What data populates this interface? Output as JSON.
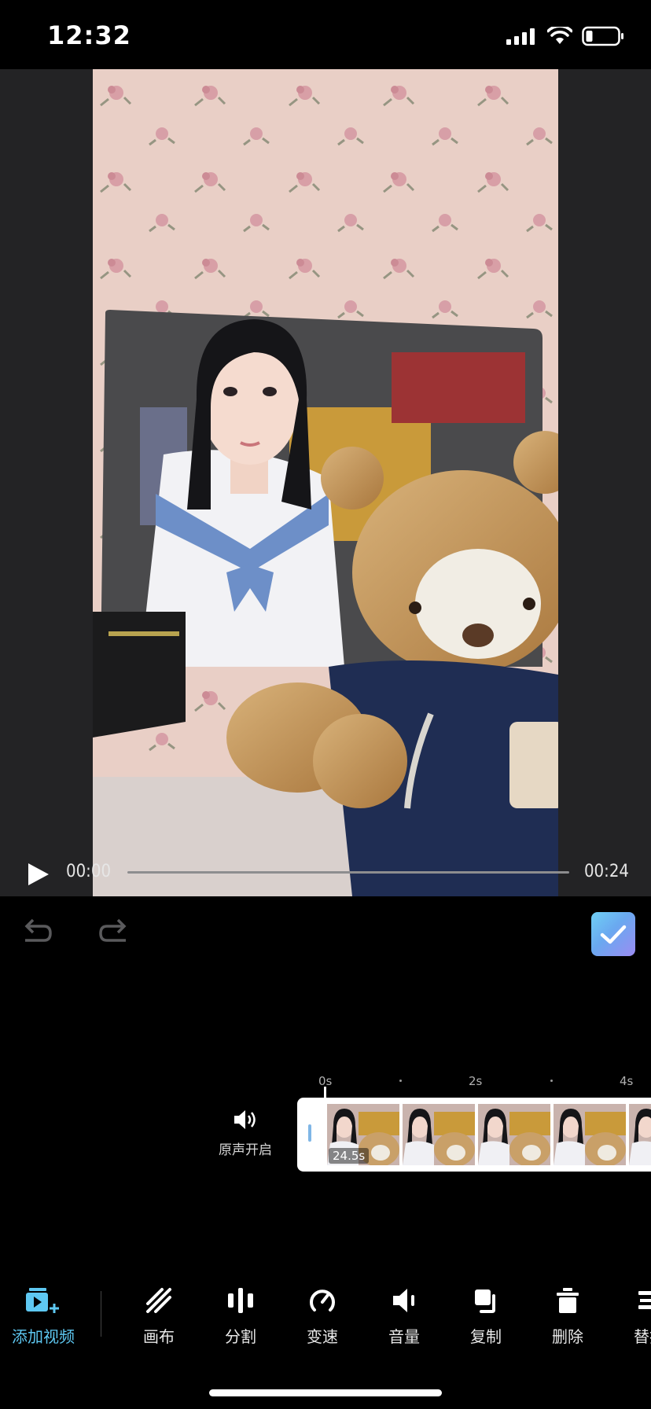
{
  "status_bar": {
    "time": "12:32"
  },
  "player": {
    "current_time": "00:00",
    "total_time": "00:24",
    "progress": 0.0
  },
  "timeline": {
    "ruler": [
      "0s",
      "2s",
      "4s"
    ],
    "original_sound_label": "原声开启",
    "clip_duration": "24.5s"
  },
  "toolbar": {
    "items": [
      {
        "label": "添加视频",
        "icon": "add-video-icon"
      },
      {
        "label": "画布",
        "icon": "canvas-icon"
      },
      {
        "label": "分割",
        "icon": "split-icon"
      },
      {
        "label": "变速",
        "icon": "speed-icon"
      },
      {
        "label": "音量",
        "icon": "volume-icon"
      },
      {
        "label": "复制",
        "icon": "copy-icon"
      },
      {
        "label": "删除",
        "icon": "delete-icon"
      },
      {
        "label": "替换",
        "icon": "replace-icon"
      }
    ]
  },
  "colors": {
    "accent": "#5ec8f2",
    "background": "#000000",
    "preview_bg": "#232325"
  }
}
